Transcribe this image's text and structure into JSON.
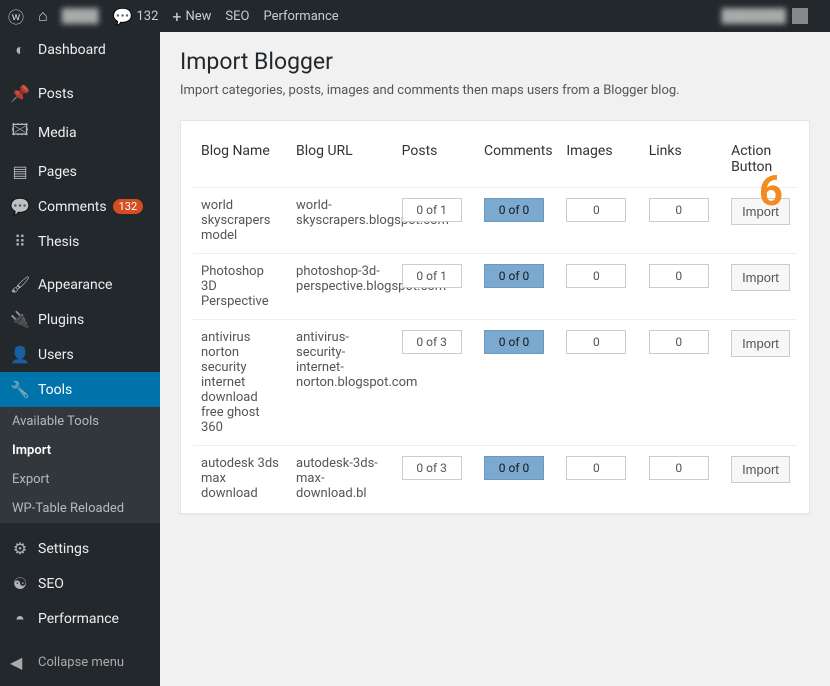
{
  "adminbar": {
    "comments_count": "132",
    "new_label": "New",
    "seo_label": "SEO",
    "perf_label": "Performance"
  },
  "sidebar": {
    "items": [
      {
        "icon": "◐",
        "label": "Dashboard",
        "name": "sidebar-item-dashboard"
      },
      {
        "icon": "📌",
        "label": "Posts",
        "name": "sidebar-item-posts"
      },
      {
        "icon": "🖾",
        "label": "Media",
        "name": "sidebar-item-media"
      },
      {
        "icon": "▤",
        "label": "Pages",
        "name": "sidebar-item-pages"
      },
      {
        "icon": "💬",
        "label": "Comments",
        "name": "sidebar-item-comments",
        "badge": "132"
      },
      {
        "icon": "⠿",
        "label": "Thesis",
        "name": "sidebar-item-thesis"
      },
      {
        "icon": "🖌",
        "label": "Appearance",
        "name": "sidebar-item-appearance"
      },
      {
        "icon": "🔌",
        "label": "Plugins",
        "name": "sidebar-item-plugins"
      },
      {
        "icon": "👤",
        "label": "Users",
        "name": "sidebar-item-users"
      },
      {
        "icon": "🔧",
        "label": "Tools",
        "name": "sidebar-item-tools",
        "active": true,
        "subs": [
          {
            "label": "Available Tools",
            "name": "sub-available-tools"
          },
          {
            "label": "Import",
            "name": "sub-import",
            "current": true
          },
          {
            "label": "Export",
            "name": "sub-export"
          },
          {
            "label": "WP-Table Reloaded",
            "name": "sub-wp-table-reloaded"
          }
        ]
      },
      {
        "icon": "⚙",
        "label": "Settings",
        "name": "sidebar-item-settings"
      },
      {
        "icon": "☯",
        "label": "SEO",
        "name": "sidebar-item-seo"
      },
      {
        "icon": "◓",
        "label": "Performance",
        "name": "sidebar-item-performance"
      }
    ],
    "collapse_label": "Collapse menu"
  },
  "page": {
    "title": "Import Blogger",
    "description": "Import categories, posts, images and comments then maps users from a Blogger blog."
  },
  "annotation": "6",
  "table": {
    "headers": {
      "name": "Blog Name",
      "url": "Blog URL",
      "posts": "Posts",
      "comments": "Comments",
      "images": "Images",
      "links": "Links",
      "action": "Action Button"
    },
    "action_label": "Import",
    "rows": [
      {
        "name": "world skyscrapers model",
        "url": "world-skyscrapers.blogspot.com",
        "posts": "0 of 1",
        "comments": "0 of 0",
        "images": "0",
        "links": "0"
      },
      {
        "name": "Photoshop 3D Perspective",
        "url": "photoshop-3d-perspective.blogspot.com",
        "posts": "0 of 1",
        "comments": "0 of 0",
        "images": "0",
        "links": "0"
      },
      {
        "name": "antivirus norton security internet download free ghost 360",
        "url": "antivirus-security-internet-norton.blogspot.com",
        "posts": "0 of 3",
        "comments": "0 of 0",
        "images": "0",
        "links": "0"
      },
      {
        "name": "autodesk 3ds max download",
        "url": "autodesk-3ds-max-download.bl",
        "posts": "0 of 3",
        "comments": "0 of 0",
        "images": "0",
        "links": "0"
      }
    ]
  }
}
